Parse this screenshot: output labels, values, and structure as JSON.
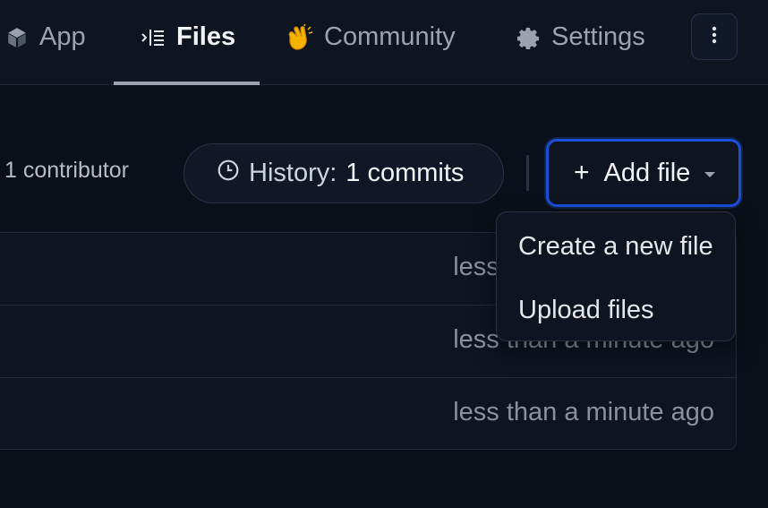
{
  "tabs": {
    "app": {
      "label": "App",
      "icon": "cube-icon"
    },
    "files": {
      "label": "Files",
      "icon": "file-tree-icon",
      "active": true
    },
    "community": {
      "label": "Community",
      "icon": "clapping-hands-icon"
    },
    "settings": {
      "label": "Settings",
      "icon": "gear-icon"
    },
    "more": {
      "icon": "vertical-ellipsis-icon"
    }
  },
  "toolbar": {
    "contributors": "1 contributor",
    "history_label": "History:",
    "history_count": "1 commits",
    "add_file_label": "Add file",
    "add_file_icon": "plus-icon"
  },
  "dropdown": {
    "items": [
      "Create a new file",
      "Upload files"
    ]
  },
  "files": {
    "rows": [
      {
        "time": "less than a minute ago"
      },
      {
        "time": "less than a minute ago"
      },
      {
        "time": "less than a minute ago"
      }
    ]
  },
  "colors": {
    "background": "#0b0f19",
    "panel": "#0f1421",
    "accent": "#1d4ed8",
    "community_icon": "#f5b300"
  }
}
